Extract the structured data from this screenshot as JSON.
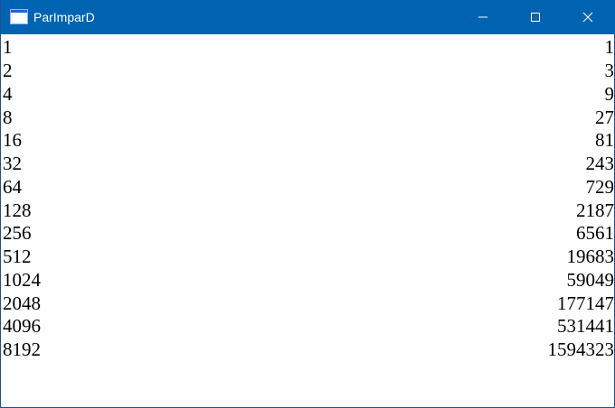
{
  "window": {
    "title": "ParImparD",
    "icon": "window-app-icon",
    "controls": {
      "minimize_icon": "minimize-icon",
      "maximize_icon": "maximize-icon",
      "close_icon": "close-icon"
    },
    "titlebar_color": "#0063b1"
  },
  "rows": [
    {
      "left": "1",
      "right": "1"
    },
    {
      "left": "2",
      "right": "3"
    },
    {
      "left": "4",
      "right": "9"
    },
    {
      "left": "8",
      "right": "27"
    },
    {
      "left": "16",
      "right": "81"
    },
    {
      "left": "32",
      "right": "243"
    },
    {
      "left": "64",
      "right": "729"
    },
    {
      "left": "128",
      "right": "2187"
    },
    {
      "left": "256",
      "right": "6561"
    },
    {
      "left": "512",
      "right": "19683"
    },
    {
      "left": "1024",
      "right": "59049"
    },
    {
      "left": "2048",
      "right": "177147"
    },
    {
      "left": "4096",
      "right": "531441"
    },
    {
      "left": "8192",
      "right": "1594323"
    }
  ]
}
